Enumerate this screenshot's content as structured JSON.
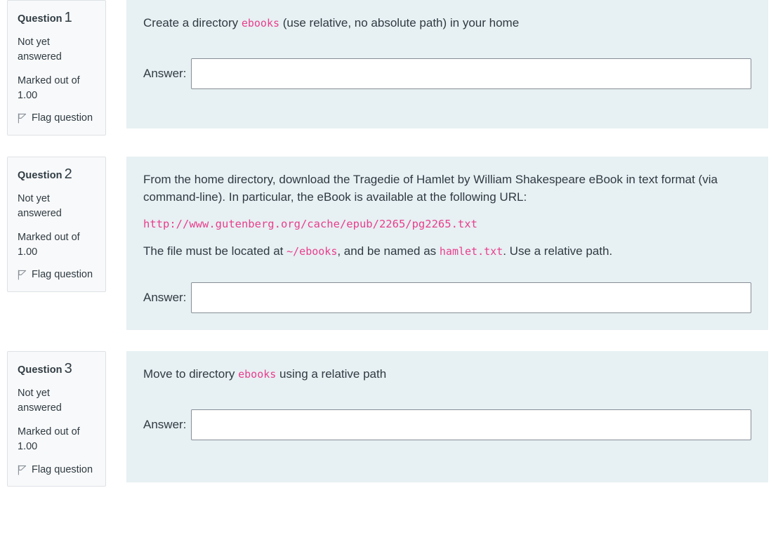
{
  "labels": {
    "question_word": "Question",
    "not_answered": "Not yet answered",
    "marked_out_of": "Marked out of",
    "flag_question": "Flag question",
    "answer_label": "Answer:",
    "flag_icon_name": "flag-icon"
  },
  "colors": {
    "content_background": "#e7f0f3",
    "info_background": "#f8f9fa",
    "info_border": "#dee2e6",
    "code_pink": "#e83e8c",
    "body_text": "#2f3b42",
    "input_border": "#868e96",
    "page_background": "#ffffff"
  },
  "questions": [
    {
      "number": "1",
      "state": "Not yet answered",
      "marks_label": "Marked out of",
      "marks_value": "1.00",
      "flag_label": "Flag question",
      "text_parts": [
        {
          "type": "text",
          "value": "Create a directory "
        },
        {
          "type": "code",
          "value": "ebooks"
        },
        {
          "type": "text",
          "value": " (use relative, no absolute path) in your home"
        }
      ],
      "answer": {
        "label": "Answer:",
        "value": "",
        "placeholder": ""
      }
    },
    {
      "number": "2",
      "state": "Not yet answered",
      "marks_label": "Marked out of",
      "marks_value": "1.00",
      "flag_label": "Flag question",
      "text_parts": [
        {
          "type": "text",
          "value": "From the home directory, download the Tragedie of Hamlet by William Shakespeare eBook in text format (via command-line). In particular, the eBook is available at the following URL:"
        }
      ],
      "url": "http://www.gutenberg.org/cache/epub/2265/pg2265.txt",
      "text_parts2": [
        {
          "type": "text",
          "value": "The file must be located at "
        },
        {
          "type": "code",
          "value": "~/ebooks"
        },
        {
          "type": "text",
          "value": ", and be named as "
        },
        {
          "type": "code",
          "value": "hamlet.txt"
        },
        {
          "type": "text",
          "value": ". Use a relative path."
        }
      ],
      "answer": {
        "label": "Answer:",
        "value": "",
        "placeholder": ""
      }
    },
    {
      "number": "3",
      "state": "Not yet answered",
      "marks_label": "Marked out of",
      "marks_value": "1.00",
      "flag_label": "Flag question",
      "text_parts": [
        {
          "type": "text",
          "value": "Move to directory "
        },
        {
          "type": "code",
          "value": "ebooks"
        },
        {
          "type": "text",
          "value": " using a relative path"
        }
      ],
      "answer": {
        "label": "Answer:",
        "value": "",
        "placeholder": ""
      }
    }
  ]
}
